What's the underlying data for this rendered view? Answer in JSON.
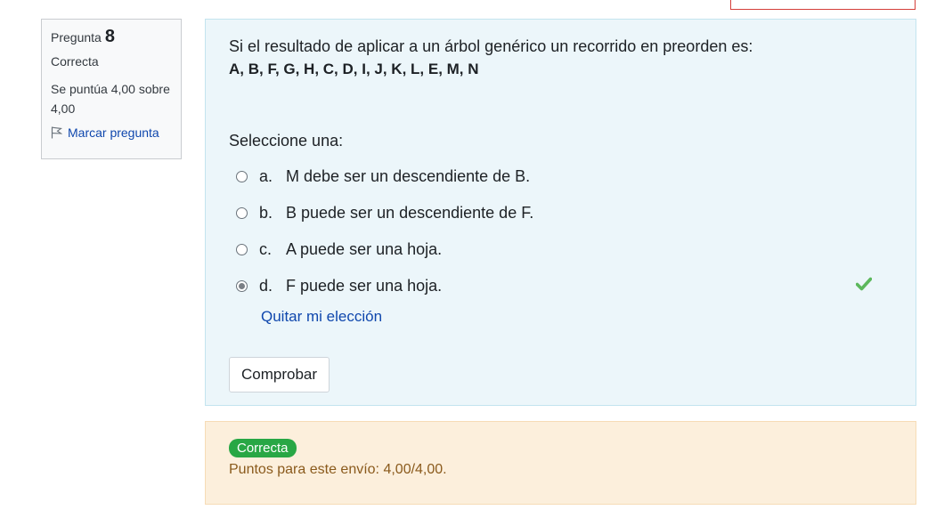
{
  "info": {
    "question_label": "Pregunta",
    "question_number": "8",
    "state": "Correcta",
    "grade": "Se puntúa 4,00 sobre 4,00",
    "flag_label": "Marcar pregunta"
  },
  "question": {
    "text": "Si el resultado de aplicar a un árbol genérico un recorrido en preorden es:",
    "sequence": "A, B, F, G, H, C, D, I, J, K, L, E, M, N",
    "prompt": "Seleccione una:",
    "answers": [
      {
        "letter": "a.",
        "text": "M debe ser un descendiente de B.",
        "selected": false
      },
      {
        "letter": "b.",
        "text": "B puede ser un descendiente de F.",
        "selected": false
      },
      {
        "letter": "c.",
        "text": "A puede ser una hoja.",
        "selected": false
      },
      {
        "letter": "d.",
        "text": "F puede ser una hoja.",
        "selected": true,
        "correct_icon": "check-icon"
      }
    ],
    "clear_choice": "Quitar mi elección",
    "submit_label": "Comprobar"
  },
  "outcome": {
    "badge": "Correcta",
    "feedback": "Puntos para este envío: 4,00/4,00."
  },
  "colors": {
    "formulation_bg": "#ecf6fa",
    "outcome_bg": "#fcefdc",
    "badge_green": "#28a745",
    "link_blue": "#0f47ad",
    "check_green": "#5cb85c"
  }
}
